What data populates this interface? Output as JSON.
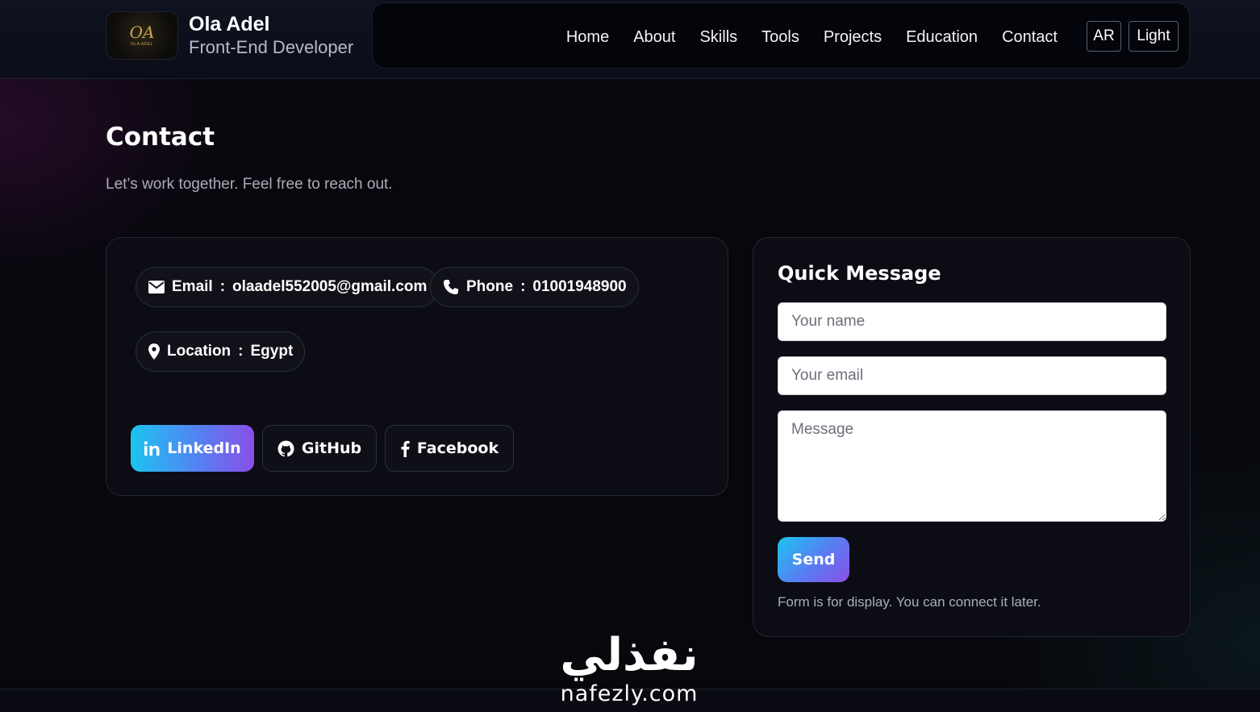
{
  "header": {
    "logo_text": "OA",
    "logo_sub": "OLA ADEL",
    "name": "Ola Adel",
    "role": "Front-End Developer",
    "nav": [
      "Home",
      "About",
      "Skills",
      "Tools",
      "Projects",
      "Education",
      "Contact"
    ],
    "lang_button": "AR",
    "theme_button": "Light"
  },
  "section": {
    "title": "Contact",
    "subtitle": "Let’s work together. Feel free to reach out."
  },
  "info": {
    "email_label": "Email",
    "email_value": "olaadel552005@gmail.com",
    "phone_label": "Phone",
    "phone_value": "01001948900",
    "location_label": "Location",
    "location_value": "Egypt",
    "separator": ":",
    "socials": [
      "LinkedIn",
      "GitHub",
      "Facebook"
    ]
  },
  "form": {
    "title": "Quick Message",
    "name_placeholder": "Your name",
    "email_placeholder": "Your email",
    "message_placeholder": "Message",
    "send_label": "Send",
    "note": "Form is for display. You can connect it later."
  },
  "watermark": {
    "arabic": "نفذلي",
    "latin": "nafezly.com"
  },
  "colors": {
    "accent_start": "#1cc4f0",
    "accent_end": "#8a4fe8",
    "background": "#07070c"
  }
}
